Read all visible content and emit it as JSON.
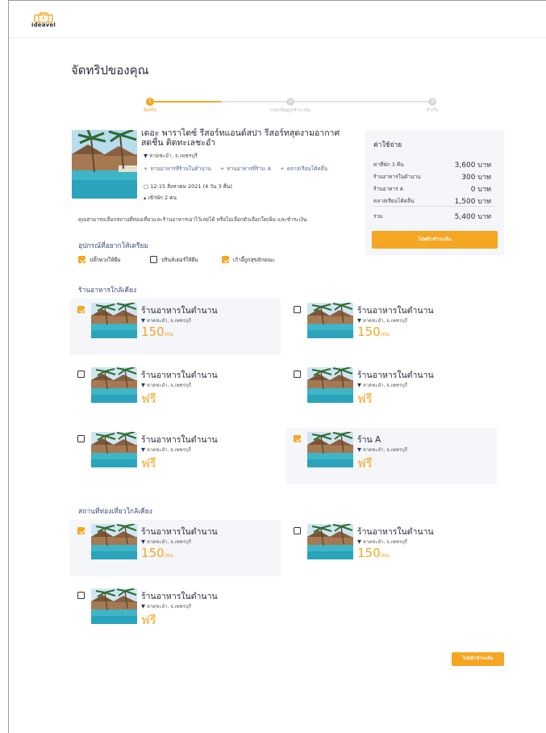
{
  "brand": {
    "logo_text": "ideavel",
    "accent": "#f5a623",
    "navy": "#3a4d78"
  },
  "page": {
    "title": "จัดทริปของคุณ"
  },
  "stepper": {
    "steps": [
      {
        "number": "1",
        "label": "จัดทริป",
        "active": true
      },
      {
        "number": "2",
        "label": "กรอกข้อมูล/ชำระเงิน",
        "active": false
      },
      {
        "number": "3",
        "label": "สำเร็จ",
        "active": false
      }
    ]
  },
  "hotel": {
    "name": "เดอะ พาราไดซ์ รีสอร์ทแอนด์สปา รีสอร์ทสุดงามอากาศสดชื่น ติดทะเลชะอำ",
    "location": "หาดชะอำ, จ.เพชรบุรี",
    "addons": [
      "+ ทานอาหารที่ร้านในตำนาน",
      "+ ทานอาหารที่ร้าน A",
      "+ คลาสเรียนโต้คลื่น"
    ],
    "dates": "12-15 สิงหาคม 2021 (4 วัน 3 คืน)",
    "guests": "เข้าพัก 2 คน"
  },
  "costs": {
    "title": "ค่าใช้จ่าย",
    "rows": [
      {
        "label": "ค่าที่พัก 3 คืน",
        "value": "3,600 บาท"
      },
      {
        "label": "ร้านอาหารในตำนาน",
        "value": "300 บาท"
      },
      {
        "label": "ร้านอาหาร A",
        "value": "0 บาท"
      },
      {
        "label": "คลาสเรียนโต้คลื่น",
        "value": "1,500 บาท"
      }
    ],
    "total_label": "รวม",
    "total_value": "5,400 บาท",
    "button": "ไปหน้าชำระเงิน"
  },
  "note": "คุณสามารถเลือกสถานที่ท่องเที่ยวและร้านอาหารเอาไว้เลยได้ หรือไม่เลือกตัวเลือกใดเพิ่ม และชำระเงิน",
  "equipment": {
    "title": "อุปกรณ์ที่อยากให้เตรียม",
    "items": [
      {
        "label": "ปลั๊กพ่วงให้ยืม",
        "checked": true
      },
      {
        "label": "ปรินท์เตอร์ให้ยืม",
        "checked": false
      },
      {
        "label": "เก้าอี้ถูกสุขลักษณะ",
        "checked": true
      }
    ]
  },
  "restaurants": {
    "title": "ร้านอาหารใกล้เคียง",
    "items": [
      {
        "name": "ร้านอาหารในตำนาน",
        "location": "หาดชะอำ, จ.เพชรบุรี",
        "price": "150",
        "unit": "/คน",
        "checked": true
      },
      {
        "name": "ร้านอาหารในตำนาน",
        "location": "หาดชะอำ, จ.เพชรบุรี",
        "price": "150",
        "unit": "/คน",
        "checked": false
      },
      {
        "name": "ร้านอาหารในตำนาน",
        "location": "หาดชะอำ, จ.เพชรบุรี",
        "price": "ฟรี",
        "unit": "",
        "checked": false
      },
      {
        "name": "ร้านอาหารในตำนาน",
        "location": "หาดชะอำ, จ.เพชรบุรี",
        "price": "ฟรี",
        "unit": "",
        "checked": false
      },
      {
        "name": "ร้านอาหารในตำนาน",
        "location": "หาดชะอำ, จ.เพชรบุรี",
        "price": "ฟรี",
        "unit": "",
        "checked": false
      },
      {
        "name": "ร้าน A",
        "location": "หาดชะอำ, จ.เพชรบุรี",
        "price": "ฟรี",
        "unit": "",
        "checked": true
      }
    ]
  },
  "attractions": {
    "title": "สถานที่ท่องเที่ยวใกล้เคียง",
    "items": [
      {
        "name": "ร้านอาหารในตำนาน",
        "location": "หาดชะอำ, จ.เพชรบุรี",
        "price": "150",
        "unit": "/คน",
        "checked": true
      },
      {
        "name": "ร้านอาหารในตำนาน",
        "location": "หาดชะอำ, จ.เพชรบุรี",
        "price": "150",
        "unit": "/คน",
        "checked": false
      },
      {
        "name": "ร้านอาหารในตำนาน",
        "location": "หาดชะอำ, จ.เพชรบุรี",
        "price": "ฟรี",
        "unit": "",
        "checked": false
      }
    ]
  },
  "footer": {
    "button": "ไปหน้าชำระเงิน"
  }
}
